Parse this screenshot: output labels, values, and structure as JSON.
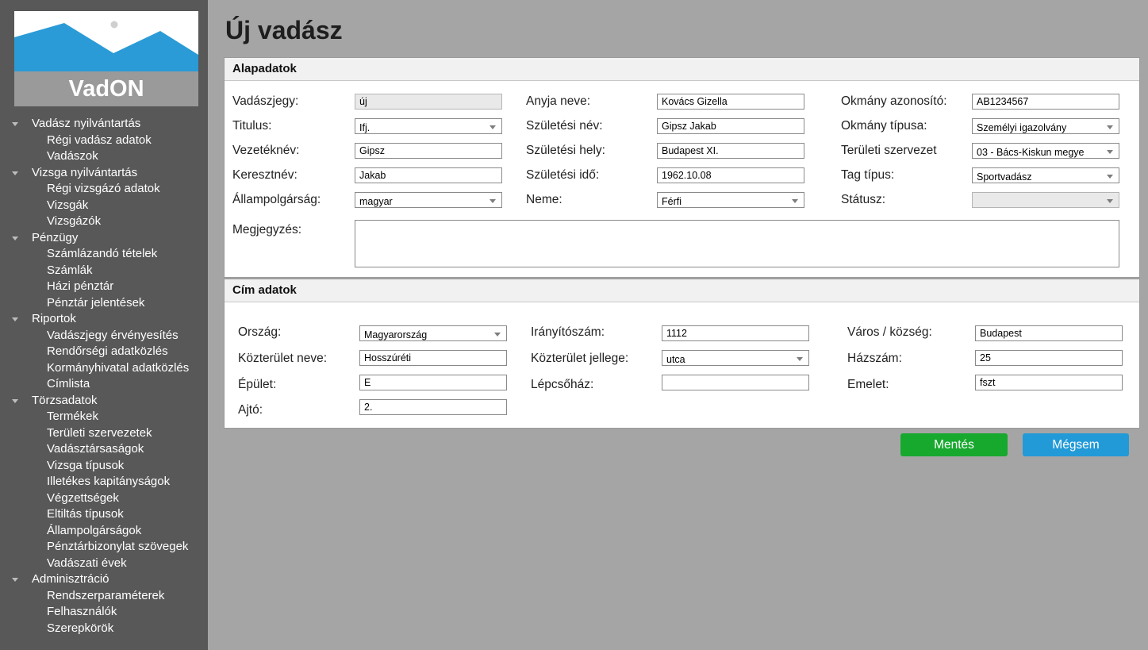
{
  "app": {
    "logo_text": "VadON"
  },
  "sidebar": {
    "groups": [
      {
        "label": "Vadász nyilvántartás",
        "items": [
          "Régi vadász adatok",
          "Vadászok"
        ]
      },
      {
        "label": "Vizsga nyilvántartás",
        "items": [
          "Régi vizsgázó adatok",
          "Vizsgák",
          "Vizsgázók"
        ]
      },
      {
        "label": "Pénzügy",
        "items": [
          "Számlázandó tételek",
          "Számlák",
          "Házi pénztár",
          "Pénztár jelentések"
        ]
      },
      {
        "label": "Riportok",
        "items": [
          "Vadászjegy érvényesítés",
          "Rendőrségi adatközlés",
          "Kormányhivatal adatközlés",
          "Címlista"
        ]
      },
      {
        "label": "Törzsadatok",
        "items": [
          "Termékek",
          "Területi szervezetek",
          "Vadásztársaságok",
          "Vizsga típusok",
          "Illetékes kapitányságok",
          "Végzettségek",
          "Eltiltás típusok",
          "Állampolgárságok",
          "Pénztárbizonylat szövegek",
          "Vadászati évek"
        ]
      },
      {
        "label": "Adminisztráció",
        "items": [
          "Rendszerparaméterek",
          "Felhasználók",
          "Szerepkörök"
        ]
      }
    ]
  },
  "page": {
    "title": "Új vadász"
  },
  "basic": {
    "section_title": "Alapadatok",
    "vadaszjegy": {
      "label": "Vadászjegy:",
      "value": "új"
    },
    "titulus": {
      "label": "Titulus:",
      "value": "Ifj."
    },
    "vezeteknev": {
      "label": "Vezetéknév:",
      "value": "Gipsz"
    },
    "keresztnev": {
      "label": "Keresztnév:",
      "value": "Jakab"
    },
    "allampolgarsag": {
      "label": "Állampolgárság:",
      "value": "magyar"
    },
    "anyja_neve": {
      "label": "Anyja neve:",
      "value": "Kovács Gizella"
    },
    "szuletesi_nev": {
      "label": "Születési név:",
      "value": "Gipsz Jakab"
    },
    "szuletesi_hely": {
      "label": "Születési hely:",
      "value": "Budapest XI."
    },
    "szuletesi_ido": {
      "label": "Születési idő:",
      "value": "1962.10.08"
    },
    "neme": {
      "label": "Neme:",
      "value": "Férfi"
    },
    "okmany_azonosito": {
      "label": "Okmány azonosító:",
      "value": "AB1234567"
    },
    "okmany_tipusa": {
      "label": "Okmány típusa:",
      "value": "Személyi igazolvány"
    },
    "teruleti_szervezet": {
      "label": "Területi szervezet",
      "value": "03 - Bács-Kiskun megye"
    },
    "tag_tipus": {
      "label": "Tag típus:",
      "value": "Sportvadász"
    },
    "statusz": {
      "label": "Státusz:",
      "value": ""
    },
    "megjegyzes": {
      "label": "Megjegyzés:",
      "value": ""
    }
  },
  "address": {
    "section_title": "Cím adatok",
    "orszag": {
      "label": "Ország:",
      "value": "Magyarország"
    },
    "kozterulet_neve": {
      "label": "Közterület neve:",
      "value": "Hosszúréti"
    },
    "epulet": {
      "label": "Épület:",
      "value": "E"
    },
    "ajto": {
      "label": "Ajtó:",
      "value": "2."
    },
    "iranyitoszam": {
      "label": "Irányítószám:",
      "value": "1112"
    },
    "kozterulet_jellege": {
      "label": "Közterület jellege:",
      "value": "utca"
    },
    "lepcsohaz": {
      "label": "Lépcsőház:",
      "value": ""
    },
    "varos": {
      "label": "Város / község:",
      "value": "Budapest"
    },
    "hazszam": {
      "label": "Házszám:",
      "value": "25"
    },
    "emelet": {
      "label": "Emelet:",
      "value": "fszt"
    }
  },
  "actions": {
    "save_label": "Mentés",
    "cancel_label": "Mégsem"
  },
  "colors": {
    "sidebar_bg": "#585858",
    "save": "#17a82e",
    "cancel": "#229ad8",
    "logo_mountain": "#2a9bd6"
  }
}
